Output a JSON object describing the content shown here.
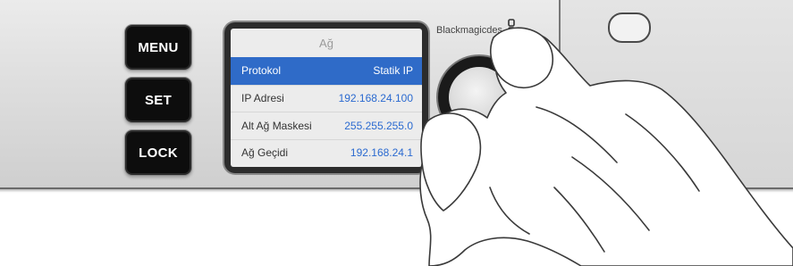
{
  "device": {
    "brand": "Blackmagicdes",
    "buttons": {
      "menu": "MENU",
      "set": "SET",
      "lock": "LOCK"
    }
  },
  "screen": {
    "title": "Ağ",
    "rows": [
      {
        "label": "Protokol",
        "value": "Statik IP",
        "selected": true
      },
      {
        "label": "IP Adresi",
        "value": "192.168.24.100",
        "selected": false
      },
      {
        "label": "Alt Ağ Maskesi",
        "value": "255.255.255.0",
        "selected": false
      },
      {
        "label": "Ağ Geçidi",
        "value": "192.168.24.1",
        "selected": false
      }
    ]
  },
  "colors": {
    "selection": "#2f6bc8",
    "value_text": "#2b6ad0",
    "button_face": "#0d0d0d"
  },
  "icons": [
    "usb-icon",
    "jog-knob"
  ]
}
